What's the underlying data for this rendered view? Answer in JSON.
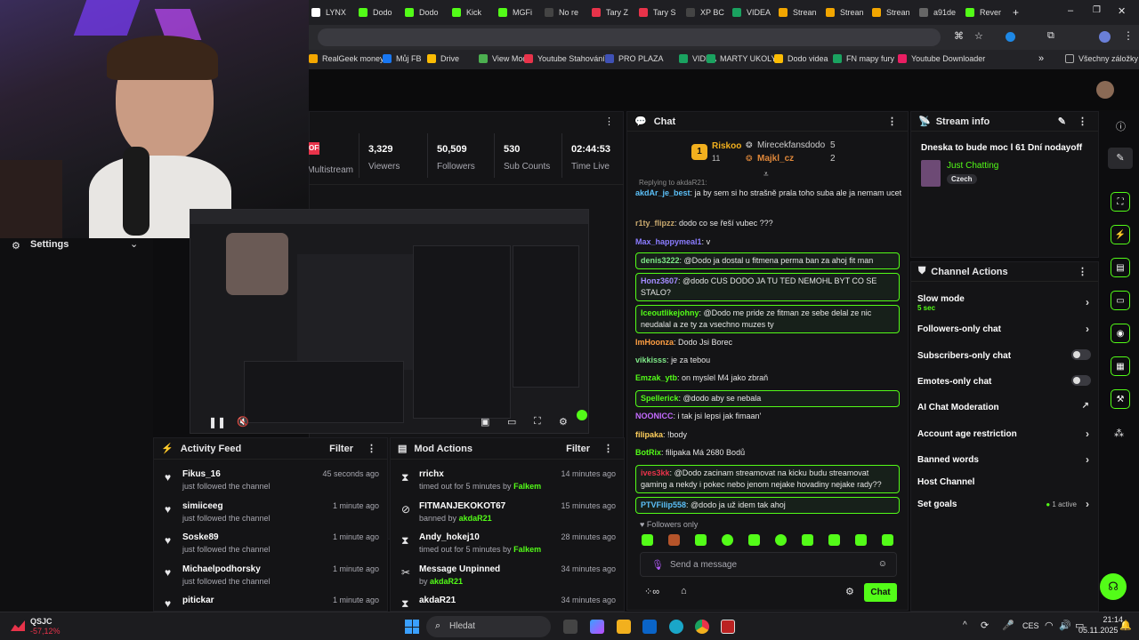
{
  "tabs": [
    {
      "label": "LYNX",
      "color": "#ffffff"
    },
    {
      "label": "Dodo",
      "color": "#53fc18"
    },
    {
      "label": "Dodo",
      "color": "#53fc18"
    },
    {
      "label": "Kick",
      "color": "#53fc18"
    },
    {
      "label": "MGFi",
      "color": "#53fc18"
    },
    {
      "label": "No re",
      "color": "#444"
    },
    {
      "label": "Tary Z",
      "color": "#e8334a"
    },
    {
      "label": "Tary S",
      "color": "#e8334a"
    },
    {
      "label": "XP BC",
      "color": "#444"
    },
    {
      "label": "VIDEA",
      "color": "#1aa260"
    },
    {
      "label": "Strean",
      "color": "#f2a600"
    },
    {
      "label": "Strean",
      "color": "#f2a600"
    },
    {
      "label": "Strean",
      "color": "#f2a600"
    },
    {
      "label": "a91de",
      "color": "#666"
    },
    {
      "label": "Rever",
      "color": "#53fc18"
    }
  ],
  "bookmarks": [
    {
      "label": "RealGeek money",
      "color": "#f2a600"
    },
    {
      "label": "Můj FB",
      "color": "#1877f2"
    },
    {
      "label": "Drive",
      "color": "#fbbc04"
    },
    {
      "label": "View Mode",
      "color": "#4caf50"
    },
    {
      "label": "Youtube Stahování",
      "color": "#e8334a"
    },
    {
      "label": "PRO PLAZA",
      "color": "#3f51b5"
    },
    {
      "label": "VIDEA",
      "color": "#1aa260"
    },
    {
      "label": "MARTY UKOLY",
      "color": "#1aa260"
    },
    {
      "label": "Dodo videa",
      "color": "#fbbc04"
    },
    {
      "label": "FN mapy fury",
      "color": "#1aa260"
    },
    {
      "label": "Youtube Downloader",
      "color": "#e91e63"
    }
  ],
  "all_bookmarks": "Všechny záložky",
  "settings_label": "Settings",
  "stats": [
    {
      "value": "3,329",
      "label": "Viewers"
    },
    {
      "value": "50,509",
      "label": "Followers"
    },
    {
      "value": "530",
      "label": "Sub Counts"
    },
    {
      "value": "02:44:53",
      "label": "Time Live"
    }
  ],
  "multistream_badge": "OFF",
  "multistream_label": "Multistream",
  "chat": {
    "title": "Chat",
    "leader": {
      "name": "Riskoo",
      "count": "11",
      "rank": "1"
    },
    "second": {
      "name": "Mirecekfansdodo",
      "count": "5"
    },
    "third": {
      "name": "Majkl_cz",
      "count": "2"
    },
    "replying": "Replying to akdaR21:",
    "messages": [
      {
        "user": "akdAr_je_best",
        "text": "ja by sem si ho strašně prala toho suba ale ja nemam ucet",
        "color": "#5bc0f8",
        "hl": false
      },
      {
        "user": "r1ty_flipzz",
        "text": "dodo co se řeší vubec ???",
        "color": "#c9a96e",
        "hl": false
      },
      {
        "user": "Max_happymeal1",
        "text": "v",
        "color": "#8b7cff",
        "hl": false
      },
      {
        "user": "denis3222",
        "text": "@Dodo ja dostal u fitmena perma ban za ahoj fit man",
        "color": "#7ee787",
        "hl": true
      },
      {
        "user": "Honz3607",
        "text": "@dodo CUS DODO JA TU TED NEMOHL BYT CO SE STALO?",
        "color": "#a48bff",
        "hl": true
      },
      {
        "user": "Iceoutlikejohny",
        "text": "@Dodo me pride ze fitman ze sebe delal ze nic neudalal a ze ty za vsechno muzes ty",
        "color": "#53fc18",
        "hl": true
      },
      {
        "user": "ImHoonza",
        "text": "Dodo Jsi Borec",
        "color": "#ff9f43",
        "hl": false
      },
      {
        "user": "vikkisss",
        "text": "je za tebou",
        "color": "#7ee787",
        "hl": false
      },
      {
        "user": "Emzak_ytb",
        "text": "on myslel M4 jako zbraň",
        "color": "#53fc18",
        "hl": false
      },
      {
        "user": "Spellerick",
        "text": "@dodo aby se nebala",
        "color": "#53fc18",
        "hl": true
      },
      {
        "user": "NOONICC",
        "text": "i tak jsi lepsi jak fimaan'",
        "color": "#c46bff",
        "hl": false
      },
      {
        "user": "filipaka",
        "text": "!body",
        "color": "#ffcf5c",
        "hl": false
      },
      {
        "user": "BotRix",
        "text": "filipaka Má 2680 Bodů",
        "color": "#53fc18",
        "hl": false
      },
      {
        "user": "ives3kk",
        "text": "@Dodo zacinam streamovat na kicku budu streamovat gaming a nekdy i pokec nebo jenom nejake hovadiny nejake rady??",
        "color": "#e8334a",
        "hl": true
      },
      {
        "user": "PTVFilip558",
        "text": "@dodo ja už idem tak ahoj",
        "color": "#5bc0f8",
        "hl": true
      }
    ],
    "followers_only": "Followers only",
    "placeholder": "Send a message",
    "send": "Chat"
  },
  "stream_info": {
    "title": "Stream info",
    "stream_title": "Dneska to bude moc l 61 Dní nodayoff",
    "category": "Just Chatting",
    "tag": "Czech"
  },
  "channel_actions": {
    "title": "Channel Actions",
    "items": [
      {
        "label": "Slow mode",
        "sub": "5 sec",
        "ctrl": "chev"
      },
      {
        "label": "Followers-only chat",
        "sub": "",
        "ctrl": "chev"
      },
      {
        "label": "Subscribers-only chat",
        "sub": "",
        "ctrl": "toggle"
      },
      {
        "label": "Emotes-only chat",
        "sub": "",
        "ctrl": "toggle"
      },
      {
        "label": "AI Chat Moderation",
        "sub": "",
        "ctrl": "ext"
      },
      {
        "label": "Account age restriction",
        "sub": "",
        "ctrl": "chev"
      },
      {
        "label": "Banned words",
        "sub": "",
        "ctrl": "chev"
      },
      {
        "label": "Host Channel",
        "sub": "",
        "ctrl": "none"
      },
      {
        "label": "Set goals",
        "sub": "",
        "ctrl": "goals"
      }
    ],
    "goals_active": "1 active"
  },
  "activity": {
    "title": "Activity Feed",
    "filter": "Filter",
    "rows": [
      {
        "name": "Fikus_16",
        "sub": "just followed the channel",
        "time": "45 seconds ago"
      },
      {
        "name": "simiiceeg",
        "sub": "just followed the channel",
        "time": "1 minute ago"
      },
      {
        "name": "Soske89",
        "sub": "just followed the channel",
        "time": "1 minute ago"
      },
      {
        "name": "Michaelpodhorsky",
        "sub": "just followed the channel",
        "time": "1 minute ago"
      },
      {
        "name": "pitickar",
        "sub": "",
        "time": "1 minute ago"
      }
    ]
  },
  "mod": {
    "title": "Mod Actions",
    "filter": "Filter",
    "rows": [
      {
        "name": "rrichx",
        "sub": "timed out for 5 minutes by",
        "by": "Falkem",
        "time": "14 minutes ago"
      },
      {
        "name": "FITMANJEKOKOT67",
        "sub": "banned by",
        "by": "akdaR21",
        "time": "15 minutes ago"
      },
      {
        "name": "Andy_hokej10",
        "sub": "timed out for 5 minutes by",
        "by": "Falkem",
        "time": "28 minutes ago"
      },
      {
        "name": "Message Unpinned",
        "sub": "by",
        "by": "akdaR21",
        "time": "34 minutes ago"
      },
      {
        "name": "akdaR21",
        "sub": "",
        "by": "",
        "time": "34 minutes ago"
      }
    ]
  },
  "taskbar": {
    "weather_name": "QSJC",
    "weather_val": "-57,12%",
    "search": "Hledat",
    "lang": "CES",
    "time": "21:14",
    "date": "05.11.2025"
  }
}
